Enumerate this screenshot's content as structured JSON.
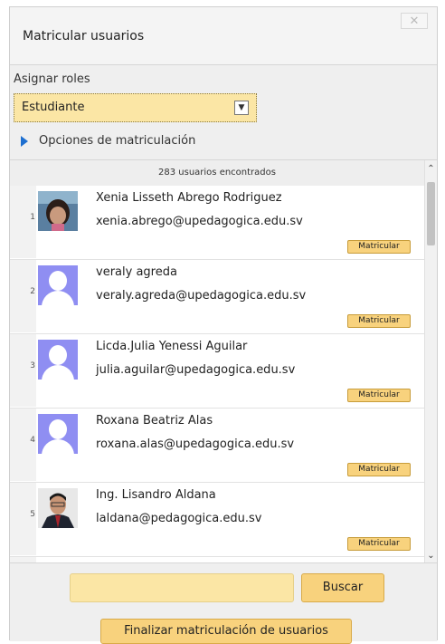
{
  "dialog": {
    "title": "Matricular usuarios",
    "close_label": "✕"
  },
  "roles": {
    "label": "Asignar roles",
    "selected": "Estudiante"
  },
  "options": {
    "label": "Opciones de matriculación"
  },
  "results": {
    "count_label": "283 usuarios encontrados"
  },
  "users": [
    {
      "index": "1",
      "name": "Xenia Lisseth Abrego Rodriguez",
      "email": "xenia.abrego@upedagogica.edu.sv",
      "avatar": "photo-woman",
      "button": "Matricular"
    },
    {
      "index": "2",
      "name": "veraly agreda",
      "email": "veraly.agreda@upedagogica.edu.sv",
      "avatar": "default-user-icon",
      "button": "Matricular"
    },
    {
      "index": "3",
      "name": "Licda.Julia Yenessi Aguilar",
      "email": "julia.aguilar@upedagogica.edu.sv",
      "avatar": "default-user-icon",
      "button": "Matricular"
    },
    {
      "index": "4",
      "name": "Roxana Beatriz Alas",
      "email": "roxana.alas@upedagogica.edu.sv",
      "avatar": "default-user-icon",
      "button": "Matricular"
    },
    {
      "index": "5",
      "name": "Ing. Lisandro Aldana",
      "email": "laldana@pedagogica.edu.sv",
      "avatar": "photo-man",
      "button": "Matricular"
    }
  ],
  "footer": {
    "search_value": "",
    "search_button": "Buscar",
    "finish_button": "Finalizar matriculación de usuarios"
  },
  "colors": {
    "accent_yellow": "#f8d27d",
    "input_yellow": "#fbe6a5",
    "avatar_purple": "#8f8ef2",
    "toggle_blue": "#1e6fd0"
  }
}
